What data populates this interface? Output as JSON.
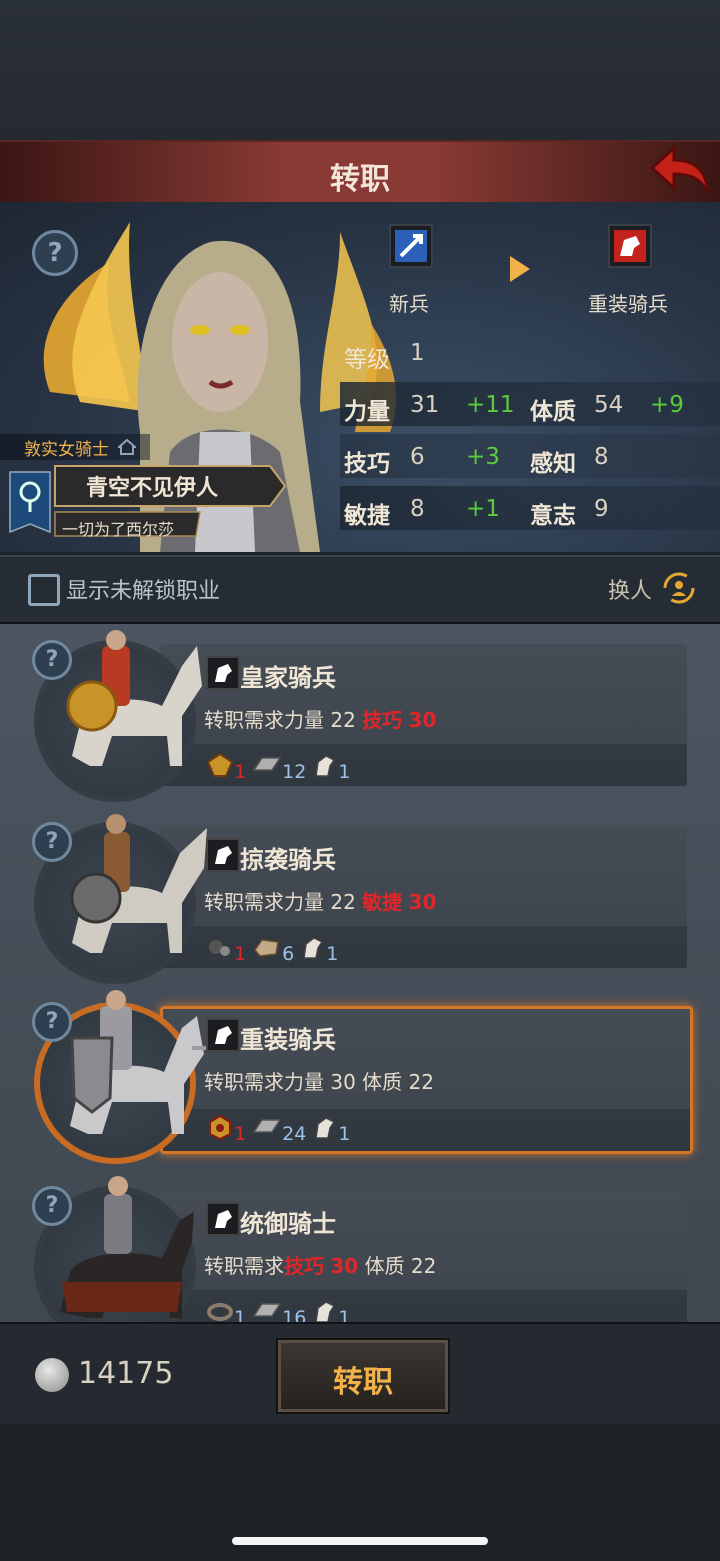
{
  "header": {
    "title": "转职"
  },
  "hero": {
    "from_class": "新兵",
    "to_class": "重装骑兵",
    "level_label": "等级",
    "level_value": "1",
    "stats": [
      {
        "name": "力量",
        "value": "31",
        "bonus": "+11"
      },
      {
        "name": "体质",
        "value": "54",
        "bonus": "+9"
      },
      {
        "name": "技巧",
        "value": "6",
        "bonus": "+3"
      },
      {
        "name": "感知",
        "value": "8",
        "bonus": ""
      },
      {
        "name": "敏捷",
        "value": "8",
        "bonus": "+1"
      },
      {
        "name": "意志",
        "value": "9",
        "bonus": ""
      }
    ],
    "title_tag": "敦实女骑士",
    "character_name": "青空不见伊人",
    "motto": "一切为了西尔莎"
  },
  "filter": {
    "show_locked_label": "显示未解锁职业",
    "switch_label": "换人"
  },
  "classes": [
    {
      "name": "皇家骑兵",
      "req_prefix": "转职需求",
      "reqs": [
        {
          "stat": "力量",
          "val": "22",
          "met": true
        },
        {
          "stat": "技巧",
          "val": "30",
          "met": false
        }
      ],
      "costs": [
        {
          "icon": "emblem-icon",
          "qty": "1",
          "short": true
        },
        {
          "icon": "iron-bar-icon",
          "qty": "12",
          "short": false
        },
        {
          "icon": "horse-icon",
          "qty": "1",
          "short": false
        }
      ],
      "selected": false
    },
    {
      "name": "掠袭骑兵",
      "req_prefix": "转职需求",
      "reqs": [
        {
          "stat": "力量",
          "val": "22",
          "met": true
        },
        {
          "stat": "敏捷",
          "val": "30",
          "met": false
        }
      ],
      "costs": [
        {
          "icon": "orb-icon",
          "qty": "1",
          "short": true
        },
        {
          "icon": "leather-icon",
          "qty": "6",
          "short": false
        },
        {
          "icon": "horse-icon",
          "qty": "1",
          "short": false
        }
      ],
      "selected": false
    },
    {
      "name": "重装骑兵",
      "req_prefix": "转职需求",
      "reqs": [
        {
          "stat": "力量",
          "val": "30",
          "met": true
        },
        {
          "stat": "体质",
          "val": "22",
          "met": true
        }
      ],
      "costs": [
        {
          "icon": "medal-icon",
          "qty": "1",
          "short": true
        },
        {
          "icon": "iron-bar-icon",
          "qty": "24",
          "short": false
        },
        {
          "icon": "horse-icon",
          "qty": "1",
          "short": false
        }
      ],
      "selected": true
    },
    {
      "name": "统御骑士",
      "req_prefix": "转职需求",
      "reqs": [
        {
          "stat": "技巧",
          "val": "30",
          "met": false
        },
        {
          "stat": "体质",
          "val": "22",
          "met": true
        }
      ],
      "costs": [
        {
          "icon": "ring-icon",
          "qty": "1",
          "short": false
        },
        {
          "icon": "iron-bar-icon",
          "qty": "16",
          "short": false
        },
        {
          "icon": "horse-icon",
          "qty": "1",
          "short": false
        }
      ],
      "selected": false
    }
  ],
  "footer": {
    "money": "14175",
    "action_label": "转职"
  },
  "colors": {
    "accent": "#f2b24a",
    "highlight": "#d4762a",
    "bonus": "#5ccc3a",
    "unmet": "#e0262a"
  }
}
